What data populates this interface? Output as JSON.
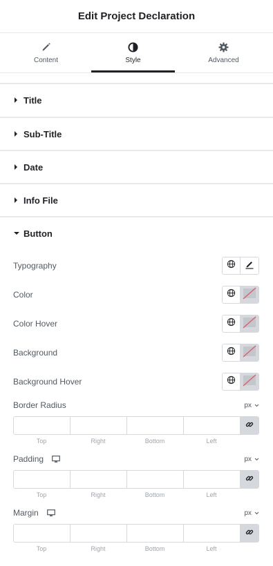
{
  "header": {
    "title": "Edit Project Declaration"
  },
  "tabs": [
    {
      "label": "Content",
      "icon": "pencil-icon"
    },
    {
      "label": "Style",
      "icon": "contrast-icon",
      "active": true
    },
    {
      "label": "Advanced",
      "icon": "gear-icon"
    }
  ],
  "sections": [
    {
      "label": "Title",
      "expanded": false
    },
    {
      "label": "Sub-Title",
      "expanded": false
    },
    {
      "label": "Date",
      "expanded": false
    },
    {
      "label": "Info File",
      "expanded": false
    },
    {
      "label": "Button",
      "expanded": true
    }
  ],
  "button_controls": [
    {
      "label": "Typography",
      "secondary_icon": "edit-icon"
    },
    {
      "label": "Color",
      "secondary_icon": "empty-color-swatch"
    },
    {
      "label": "Color Hover",
      "secondary_icon": "empty-color-swatch"
    },
    {
      "label": "Background",
      "secondary_icon": "empty-color-swatch"
    },
    {
      "label": "Background Hover",
      "secondary_icon": "empty-color-swatch"
    }
  ],
  "dimensions": [
    {
      "label": "Border Radius",
      "unit": "px",
      "responsive": false,
      "values": [
        "",
        "",
        "",
        ""
      ]
    },
    {
      "label": "Padding",
      "unit": "px",
      "responsive": true,
      "values": [
        "",
        "",
        "",
        ""
      ]
    },
    {
      "label": "Margin",
      "unit": "px",
      "responsive": true,
      "values": [
        "",
        "",
        "",
        ""
      ]
    }
  ],
  "dimension_sides": [
    "Top",
    "Right",
    "Bottom",
    "Left"
  ],
  "colors": {
    "text": "#1f2124",
    "muted": "#515962",
    "border": "#d5d8dc",
    "swatch_slash": "#e05a6a"
  }
}
